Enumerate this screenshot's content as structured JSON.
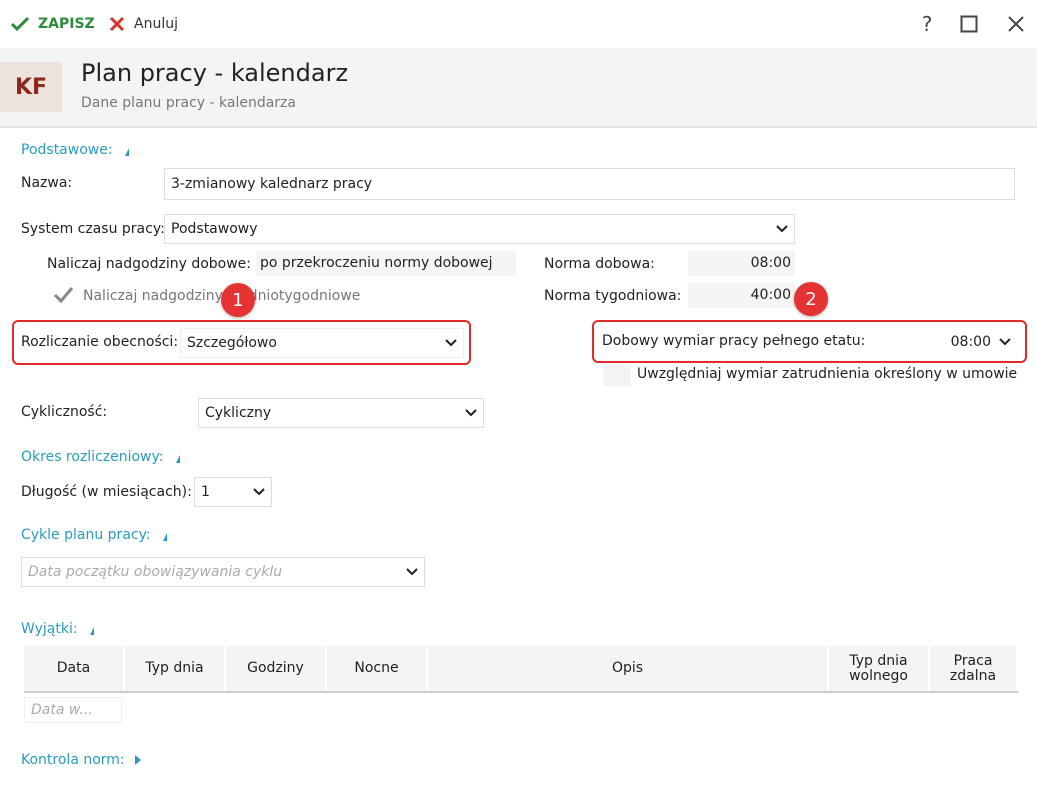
{
  "toolbar": {
    "save_label": "ZAPISZ",
    "cancel_label": "Anuluj",
    "help": "?",
    "maximize": "☐",
    "close": "✕"
  },
  "header": {
    "initials": "KF",
    "title": "Plan pracy - kalendarz",
    "subtitle": "Dane planu pracy - kalendarza"
  },
  "basic": {
    "section": "Podstawowe:",
    "name_label": "Nazwa:",
    "name_value": "3-zmianowy kalednarz pracy",
    "system_label": "System czasu pracy:",
    "system_value": "Podstawowy",
    "overtime_daily_label": "Naliczaj nadgodziny dobowe:",
    "overtime_daily_value": "po przekroczeniu normy dobowej",
    "overtime_weekly_label": "Naliczaj nadgodziny średniotygodniowe",
    "norm_daily_label": "Norma dobowa:",
    "norm_daily_value": "08:00",
    "norm_weekly_label": "Norma tygodniowa:",
    "norm_weekly_value": "40:00",
    "attendance_label": "Rozliczanie obecności:",
    "attendance_value": "Szczegółowo",
    "fulltime_label": "Dobowy wymiar pracy pełnego etatu:",
    "fulltime_value": "08:00",
    "consider_label": "Uwzględniaj wymiar zatrudnienia określony w umowie",
    "cyclic_label": "Cykliczność:",
    "cyclic_value": "Cykliczny"
  },
  "badges": {
    "one": "1",
    "two": "2"
  },
  "period": {
    "section": "Okres rozliczeniowy:",
    "length_label": "Długość (w miesiącach):",
    "length_value": "1"
  },
  "cycles": {
    "section": "Cykle planu pracy:",
    "date_placeholder": "Data początku obowiązywania cyklu"
  },
  "exceptions": {
    "section": "Wyjątki:",
    "columns": [
      "Data",
      "Typ dnia",
      "Godziny",
      "Nocne",
      "Opis",
      "Typ dnia wolnego",
      "Praca zdalna"
    ],
    "date_placeholder": "Data w..."
  },
  "norms": {
    "section": "Kontrola norm:"
  },
  "colors": {
    "accent": "#2a9bbf",
    "save": "#2e8b3d",
    "cancel": "#d9302c",
    "highlight": "#e02b2b"
  }
}
